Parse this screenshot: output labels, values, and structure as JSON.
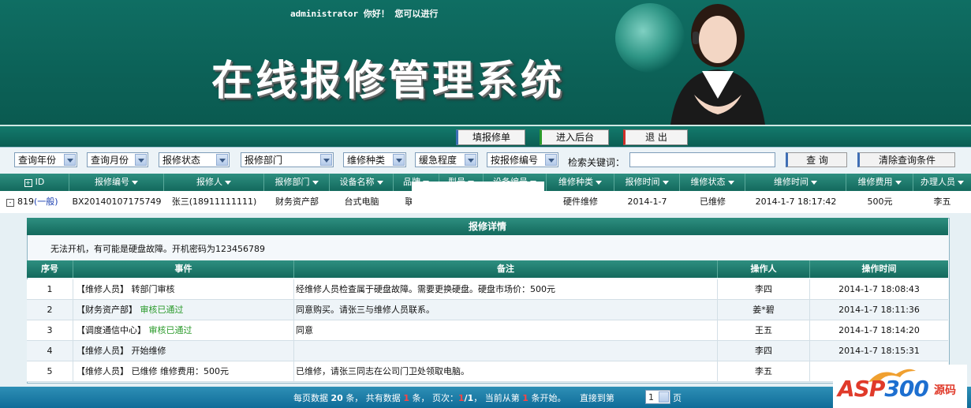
{
  "header": {
    "title": "在线报修管理系统",
    "greeting_user": "administrator",
    "greeting_text": "你好！ 您可以进行",
    "btn_fill": "填报修单",
    "btn_admin": "进入后台",
    "btn_logout": "退 出"
  },
  "filters": {
    "year": "查询年份",
    "month": "查询月份",
    "status": "报修状态",
    "dept": "报修部门",
    "type": "维修种类",
    "urgency": "缓急程度",
    "by_number": "按报修编号",
    "keyword_label": "检索关键词：",
    "keyword_value": "",
    "search_btn": "查 询",
    "clear_btn": "清除查询条件"
  },
  "grid": {
    "columns": [
      "ID",
      "报修编号",
      "报修人",
      "报修部门",
      "设备名称",
      "品牌",
      "型号",
      "设备编号",
      "维修种类",
      "报修时间",
      "维修状态",
      "维修时间",
      "维修费用",
      "办理人员"
    ],
    "row": {
      "id": "819",
      "level": "(一般)",
      "number": "BX20140107175749",
      "reporter": "张三(18911111111)",
      "dept": "财务资产部",
      "device": "台式电脑",
      "brand": "联",
      "repair_type": "硬件维修",
      "report_time": "2014-1-7",
      "status": "已维修",
      "repair_time": "2014-1-7 18:17:42",
      "cost": "500元",
      "handler": "李五"
    }
  },
  "detail": {
    "title": "报修详情",
    "description": "无法开机，有可能是硬盘故障。开机密码为123456789",
    "columns": [
      "序号",
      "事件",
      "备注",
      "操作人",
      "操作时间"
    ],
    "rows": [
      {
        "no": "1",
        "event_a": "【维修人员】 转部门审核",
        "event_b": "",
        "note": "经维修人员检查属于硬盘故障。需要更换硬盘。硬盘市场价：500元",
        "op": "李四",
        "time": "2014-1-7 18:08:43"
      },
      {
        "no": "2",
        "event_a": "【财务资产部】",
        "event_b": "审核已通过",
        "note": "同意购买。请张三与维修人员联系。",
        "op": "姜*碧",
        "time": "2014-1-7 18:11:36"
      },
      {
        "no": "3",
        "event_a": "【调度通信中心】",
        "event_b": "审核已通过",
        "note": "同意",
        "op": "王五",
        "time": "2014-1-7 18:14:20"
      },
      {
        "no": "4",
        "event_a": "【维修人员】 开始维修",
        "event_b": "",
        "note": "",
        "op": "李四",
        "time": "2014-1-7 18:15:31"
      },
      {
        "no": "5",
        "event_a": "【维修人员】 已维修 维修费用：500元",
        "event_b": "",
        "note": "已维修，请张三同志在公司门卫处领取电脑。",
        "op": "李五",
        "time": ""
      }
    ]
  },
  "footer": {
    "t1": "每页数据",
    "per_page": "20",
    "t2": "条， 共有数据",
    "total": "1",
    "t3": "条， 页次：",
    "page_cur": "1",
    "page_total": "/1",
    "t4": "， 当前从第",
    "start": "1",
    "t5": "条开始。",
    "t6": "直接到第",
    "page_sel": "1",
    "t7": "页"
  },
  "logo": {
    "text_a": "ASP",
    "text_b": "300",
    "text_c": "源码"
  }
}
